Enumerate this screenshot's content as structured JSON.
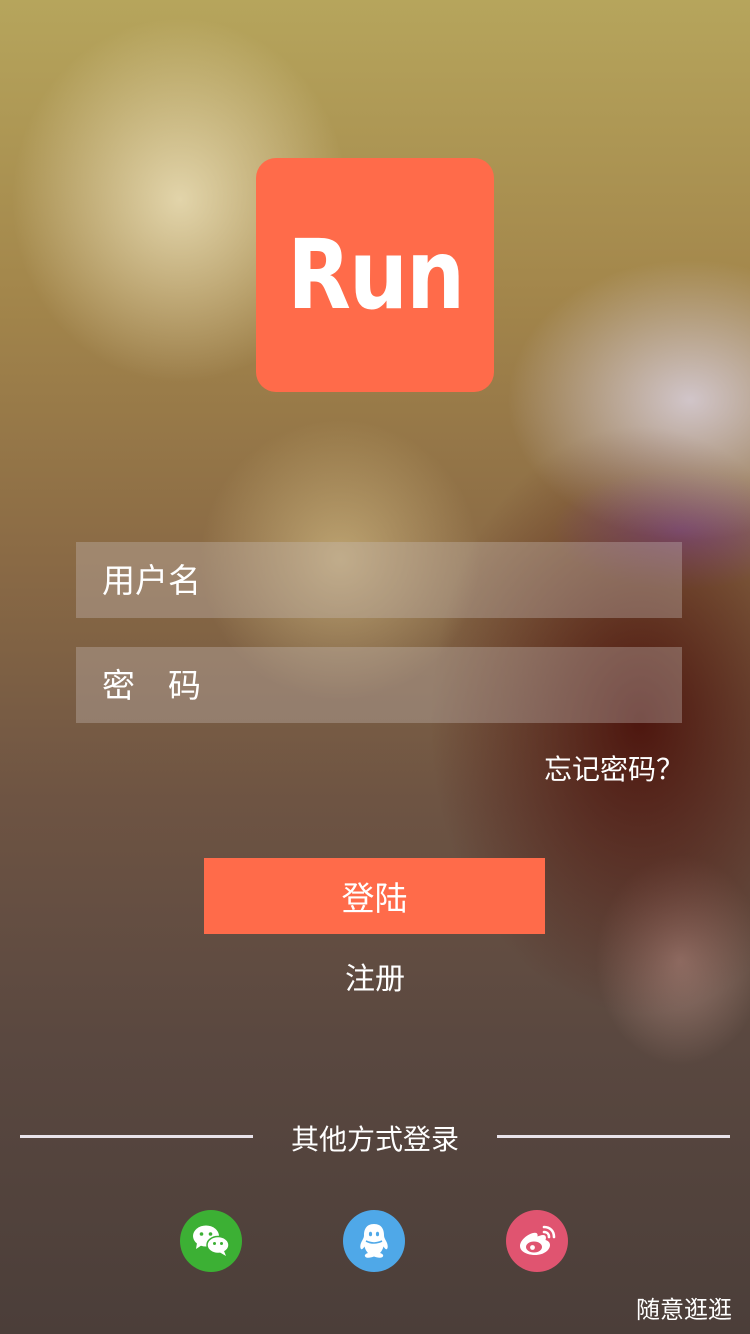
{
  "logo": {
    "text": "Run",
    "color": "#ff6b4a"
  },
  "login_form": {
    "username_placeholder": "用户名",
    "username_value": "",
    "password_placeholder": "密　码",
    "password_value": "",
    "forgot_password": "忘记密码？",
    "login_button": "登陆",
    "register_link": "注册"
  },
  "other_login": {
    "title": "其他方式登录",
    "providers": [
      {
        "icon": "wechat-icon",
        "color": "#3cb034"
      },
      {
        "icon": "qq-icon",
        "color": "#4fa8e8"
      },
      {
        "icon": "weibo-icon",
        "color": "#e05470"
      }
    ]
  },
  "browse_link": "随意逛逛",
  "colors": {
    "accent": "#ff6b4a",
    "text": "#ffffff"
  }
}
